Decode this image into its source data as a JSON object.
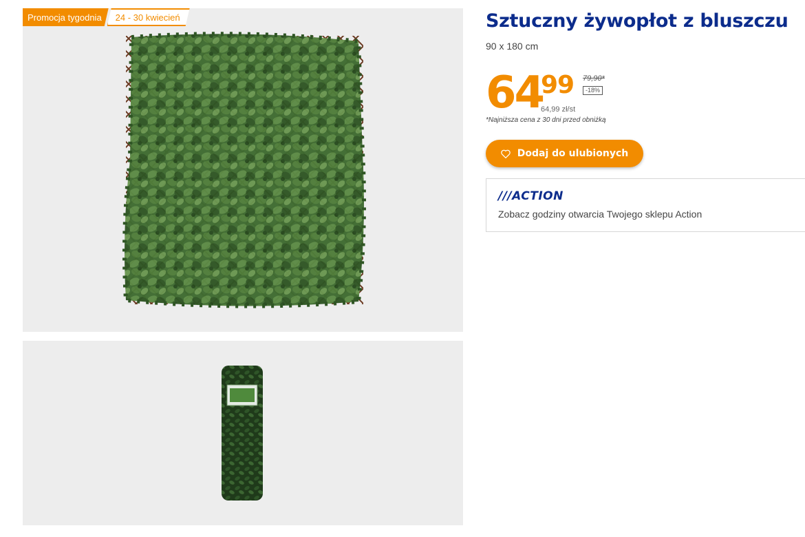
{
  "promo": {
    "label": "Promocja tygodnia",
    "dates": "24 - 30 kwiecień"
  },
  "product": {
    "title": "Sztuczny żywopłot z bluszczu",
    "size": "90 x 180 cm",
    "price_main": "64",
    "price_cents": "99",
    "old_price": "79,90*",
    "discount": "-18%",
    "unit_price": "64,99 zł/st",
    "lowest_price_note": "*Najniższa cena z 30 dni przed obniżką"
  },
  "favorite_button": {
    "label": "Dodaj do ulubionych",
    "icon": "heart-icon"
  },
  "store": {
    "logo_text": "///ACTION",
    "hours_link": "Zobacz godziny otwarcia Twojego sklepu Action"
  },
  "colors": {
    "accent": "#f28c00",
    "brand": "#0c2c8c",
    "panel_bg": "#ededed"
  },
  "images": [
    {
      "name": "ivy-hedge-trellis-image"
    },
    {
      "name": "ivy-hedge-rolled-package-image"
    }
  ]
}
